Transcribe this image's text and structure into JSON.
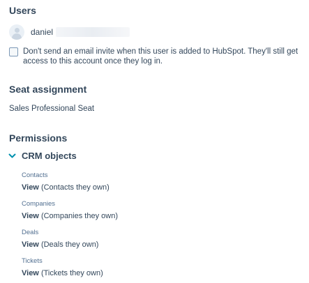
{
  "users": {
    "title": "Users",
    "user_name": "daniel",
    "invite_checkbox_label": "Don't send an email invite when this user is added to HubSpot. They'll still get access to this account once they log in."
  },
  "seat_assignment": {
    "title": "Seat assignment",
    "value": "Sales Professional Seat"
  },
  "permissions": {
    "title": "Permissions",
    "crm_objects": {
      "title": "CRM objects",
      "items": [
        {
          "label": "Contacts",
          "level": "View",
          "scope": "(Contacts they own)"
        },
        {
          "label": "Companies",
          "level": "View",
          "scope": "(Companies they own)"
        },
        {
          "label": "Deals",
          "level": "View",
          "scope": "(Deals they own)"
        },
        {
          "label": "Tickets",
          "level": "View",
          "scope": "(Tickets they own)"
        }
      ]
    }
  },
  "colors": {
    "text": "#33475b",
    "label": "#516f90",
    "accent": "#0091ae"
  },
  "icons": {
    "avatar": "default-avatar-icon",
    "chevron": "chevron-down-icon"
  }
}
